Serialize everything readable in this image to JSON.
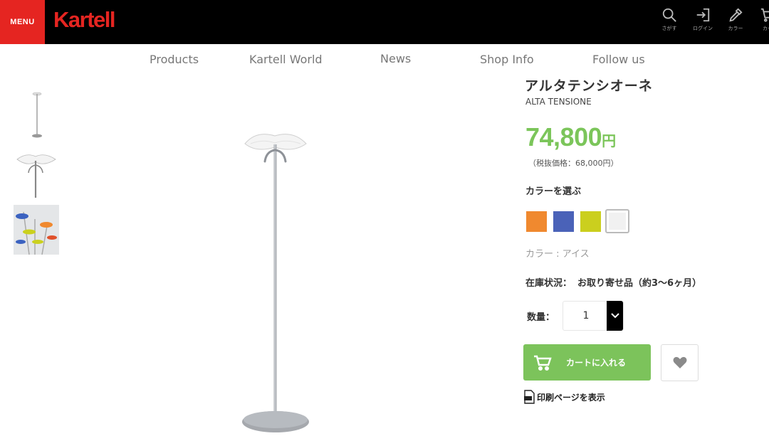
{
  "header": {
    "menu_label": "MENU",
    "logo_text": "Kartell",
    "icons": [
      {
        "name": "search-icon",
        "label": "さがす"
      },
      {
        "name": "login-icon",
        "label": "ログイン"
      },
      {
        "name": "color-dropper-icon",
        "label": "カラー"
      },
      {
        "name": "cart-icon",
        "label": "カー"
      }
    ]
  },
  "nav": {
    "items": [
      "Products",
      "Kartell World",
      "News",
      "Shop Info",
      "Follow us"
    ]
  },
  "gallery": {
    "thumbnails": [
      "thumbnail-full-stand",
      "thumbnail-top-detail",
      "thumbnail-color-variants"
    ]
  },
  "product": {
    "name_jp": "アルタテンシオーネ",
    "name_en": "ALTA TENSIONE",
    "price": "74,800",
    "price_unit": "円",
    "tax_excluded": "（税抜価格：68,000円）",
    "color_title": "カラーを選ぶ",
    "swatches": [
      {
        "name": "orange",
        "hex": "#f0892f"
      },
      {
        "name": "blue",
        "hex": "#4a62b8"
      },
      {
        "name": "yellow",
        "hex": "#cbcf1e"
      },
      {
        "name": "ice",
        "hex": "#f1f1f1",
        "selected": true
      }
    ],
    "color_label": "カラー : アイス",
    "stock_label": "在庫状況：",
    "stock_value": "お取り寄せ品（約3〜6ヶ月）",
    "qty_label": "数量：",
    "qty_value": "1",
    "cart_button": "カートに入れる",
    "print_link": "印刷ページを表示"
  },
  "colors": {
    "accent_red": "#e52521",
    "price_green": "#7bc55a",
    "cart_green": "#7cc35b",
    "header_black": "#000000"
  }
}
